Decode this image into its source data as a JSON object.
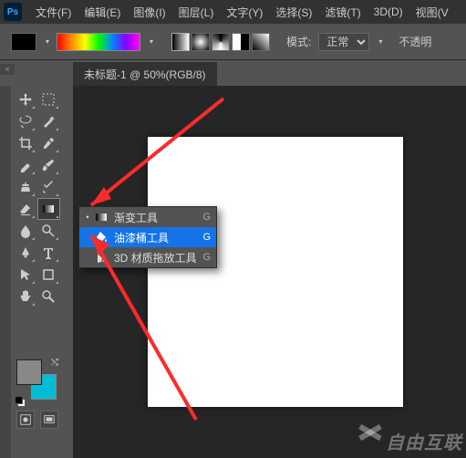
{
  "app": {
    "ps_label": "Ps"
  },
  "menu": {
    "file": "文件(F)",
    "edit": "编辑(E)",
    "image": "图像(I)",
    "layer": "图层(L)",
    "type": "文字(Y)",
    "select": "选择(S)",
    "filter": "滤镜(T)",
    "threeD": "3D(D)",
    "view": "视图(V"
  },
  "options": {
    "mode_label": "模式:",
    "mode_value": "正常",
    "opacity_label": "不透明"
  },
  "document": {
    "tab_title": "未标题-1 @ 50%(RGB/8)"
  },
  "flyout": {
    "items": [
      {
        "label": "渐变工具",
        "shortcut": "G",
        "current": true
      },
      {
        "label": "油漆桶工具",
        "shortcut": "G",
        "current": false
      },
      {
        "label": "3D 材质拖放工具",
        "shortcut": "G",
        "current": false
      }
    ]
  },
  "watermark": {
    "text": "自由互联"
  }
}
